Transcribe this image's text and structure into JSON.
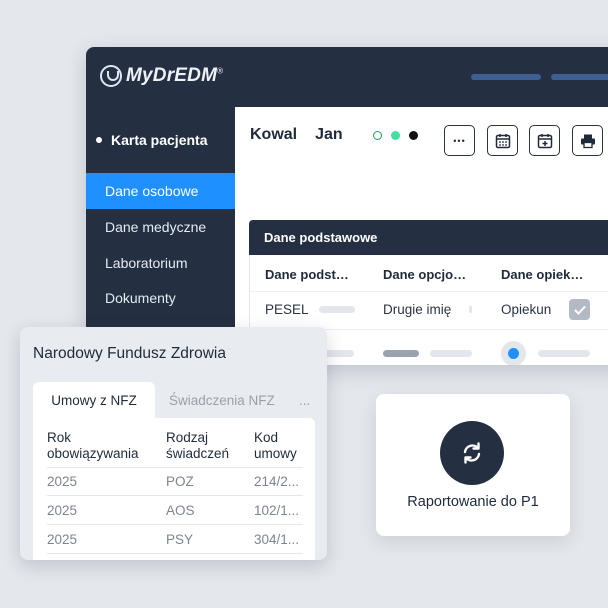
{
  "app": {
    "logo_text": "MyDrEDM",
    "logo_mark": "®"
  },
  "sidebar": {
    "section_title": "Karta pacjenta",
    "items": [
      {
        "label": "Dane osobowe",
        "active": true
      },
      {
        "label": "Dane medyczne",
        "active": false
      },
      {
        "label": "Laboratorium",
        "active": false
      },
      {
        "label": "Dokumenty",
        "active": false
      }
    ]
  },
  "patient": {
    "last_name": "Kowal",
    "first_name": "Jan",
    "status_colors": [
      "#1c9e57",
      "#3fe0a0",
      "#111111"
    ]
  },
  "toolbar": {
    "icons": [
      "more-icon",
      "calendar-icon",
      "calendar-add-icon",
      "print-icon"
    ],
    "more_glyph": "•••"
  },
  "card": {
    "title": "Dane podstawowe",
    "columns": [
      "Dane podst…",
      "Dane opcjo…",
      "Dane opiek…"
    ],
    "row1": {
      "col1": "PESEL",
      "col2": "Drugie imię",
      "col3": "Opiekun"
    },
    "guardian_checked": true,
    "radio_selected": 0
  },
  "nfz": {
    "title": "Narodowy Fundusz Zdrowia",
    "tabs": [
      "Umowy z NFZ",
      "Świadczenia NFZ",
      "..."
    ],
    "headers": [
      {
        "line1": "Rok",
        "line2": "obowiązywania"
      },
      {
        "line1": "Rodzaj",
        "line2": "świadczeń"
      },
      {
        "line1": "Kod",
        "line2": "umowy"
      }
    ],
    "rows": [
      {
        "year": "2025",
        "type": "POZ",
        "code": "214/2..."
      },
      {
        "year": "2025",
        "type": "AOS",
        "code": "102/1..."
      },
      {
        "year": "2025",
        "type": "PSY",
        "code": "304/1..."
      }
    ]
  },
  "p1": {
    "label": "Raportowanie do P1",
    "icon": "sync-icon"
  },
  "colors": {
    "navy": "#243042",
    "accent_blue": "#1e90ff",
    "background": "#e4e7ec"
  }
}
